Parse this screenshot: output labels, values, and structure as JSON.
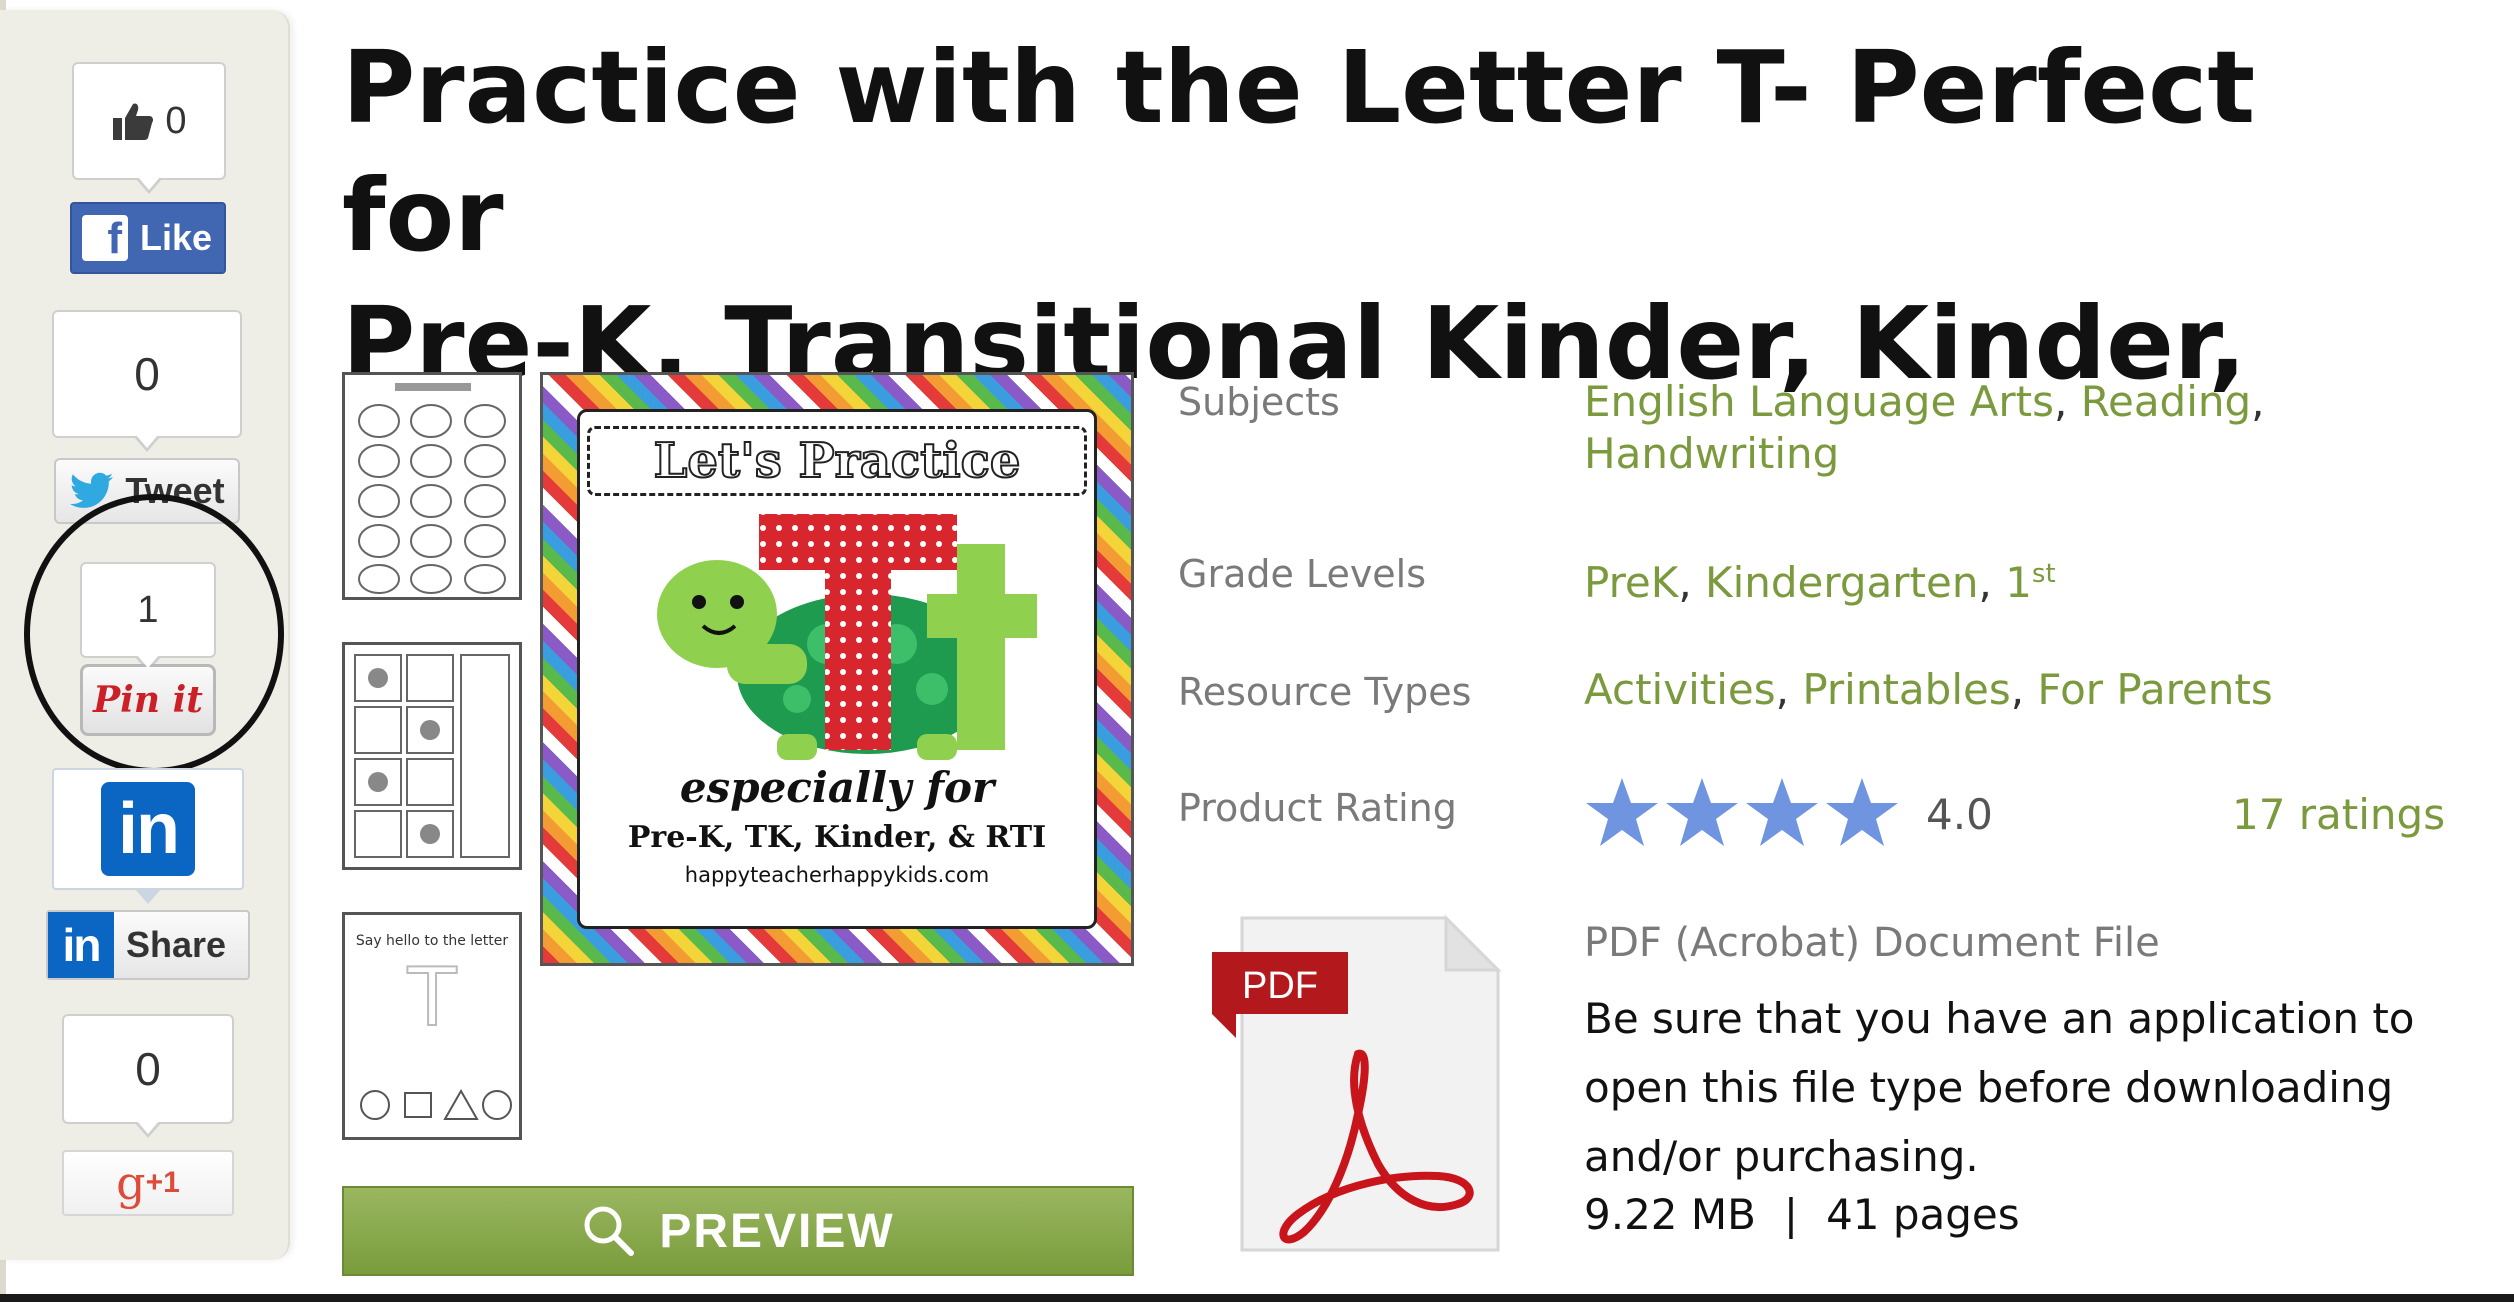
{
  "title": {
    "line1": "Practice with the Letter T- Perfect for",
    "line2": "Pre-K, Transitional Kinder, Kinder, RTI"
  },
  "social": {
    "facebook": {
      "count": "0",
      "label": "Like"
    },
    "twitter": {
      "count": "0",
      "label": "Tweet"
    },
    "pinterest": {
      "count": "1",
      "label": "Pin it"
    },
    "linkedin": {
      "label": "Share"
    },
    "googleplus": {
      "count": "0",
      "label": "g",
      "suffix": "+1"
    }
  },
  "cover": {
    "heading": "Let's Practice",
    "letter": "Tt",
    "subtitle": "especially for",
    "audience": "Pre-K, TK, Kinder, & RTI",
    "website": "happyteacherhappykids.com"
  },
  "thumb3": {
    "text": "Say hello to the letter",
    "letter": "T"
  },
  "preview_label": "PREVIEW",
  "details": {
    "subjects_label": "Subjects",
    "subjects": [
      "English Language Arts",
      "Reading",
      "Handwriting"
    ],
    "grades_label": "Grade Levels",
    "grades": [
      "PreK",
      "Kindergarten",
      "1",
      "st"
    ],
    "types_label": "Resource Types",
    "types": [
      "Activities",
      "Printables",
      "For Parents"
    ],
    "rating_label": "Product Rating",
    "rating_value": "4.0",
    "rating_stars": 4,
    "rating_count": "17 ratings"
  },
  "file": {
    "badge": "PDF",
    "type": "PDF (Acrobat) Document File",
    "note": "Be sure that you have an application to open this file type before downloading and/or purchasing.",
    "size": "9.22 MB",
    "separator": "|",
    "pages": "41 pages"
  },
  "colors": {
    "accent_green": "#7b9a3e",
    "preview_button": "#8aab4d",
    "star_blue": "#6f94e0",
    "facebook": "#4267b2",
    "linkedin": "#0a66c2",
    "pinterest": "#cb2027",
    "googleplus": "#dd4b39",
    "pdf_red": "#b3191c"
  },
  "icons": [
    "thumbs-up-icon",
    "facebook-logo-icon",
    "twitter-bird-icon",
    "linkedin-logo-icon",
    "search-icon",
    "star-icon",
    "pdf-file-icon",
    "turtle-illustration"
  ]
}
